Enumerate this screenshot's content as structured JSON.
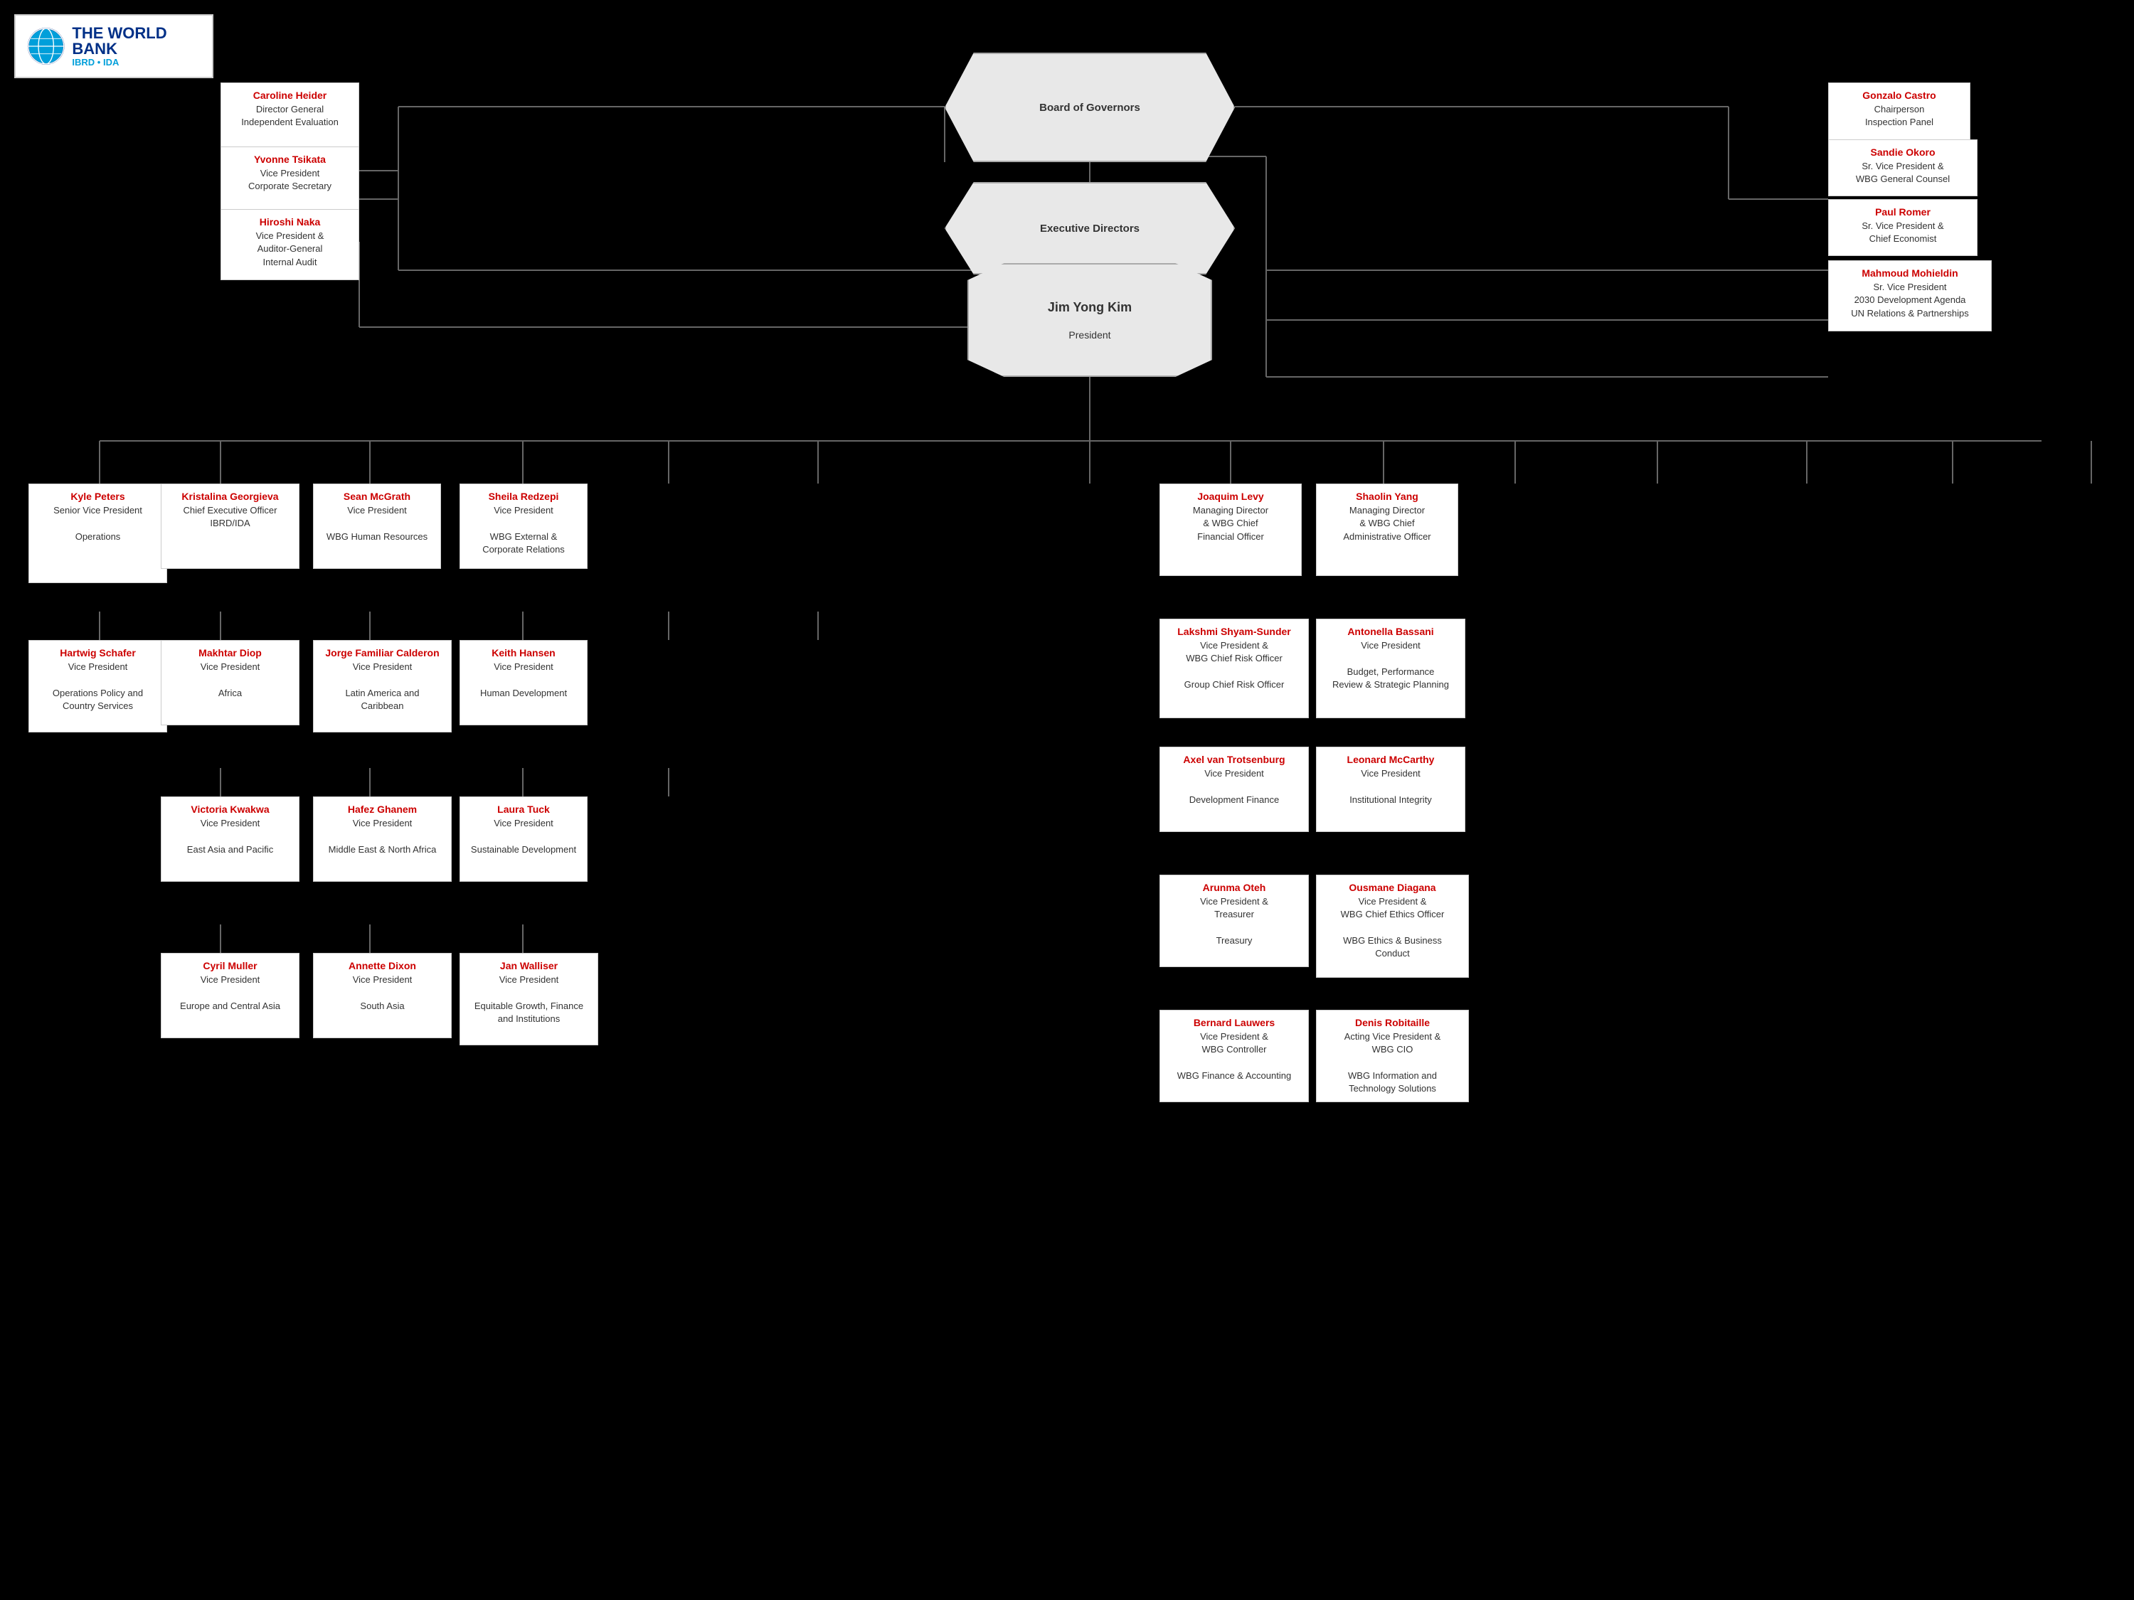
{
  "logo": {
    "title": "THE WORLD BANK",
    "subtitle": "IBRD • IDA"
  },
  "board_of_governors": {
    "label": "Board of Governors"
  },
  "executive_directors": {
    "label": "Executive Directors"
  },
  "president": {
    "name": "Jim Yong Kim",
    "title": "President"
  },
  "cards": {
    "caroline_heider": {
      "name": "Caroline Heider",
      "title": "Director General\nIndependent Evaluation"
    },
    "gonzalo_castro": {
      "name": "Gonzalo Castro",
      "title": "Chairperson\nInspection Panel"
    },
    "yvonne_tsikata": {
      "name": "Yvonne Tsikata",
      "title": "Vice President\nCorporate Secretary"
    },
    "hiroshi_naka": {
      "name": "Hiroshi Naka",
      "title": "Vice President &\nAuditor-General\nInternal Audit"
    },
    "sandie_okoro": {
      "name": "Sandie Okoro",
      "title": "Sr. Vice President &\nWBG General Counsel"
    },
    "paul_romer": {
      "name": "Paul Romer",
      "title": "Sr. Vice President &\nChief Economist"
    },
    "mahmoud_mohieldin": {
      "name": "Mahmoud Mohieldin",
      "title": "Sr. Vice President\n2030 Development Agenda\nUN Relations & Partnerships"
    },
    "kyle_peters": {
      "name": "Kyle Peters",
      "title": "Senior Vice President\n\nOperations"
    },
    "kristalina_georgieva": {
      "name": "Kristalina Georgieva",
      "title": "Chief Executive Officer\nIBRD/IDA"
    },
    "sean_mcgrath": {
      "name": "Sean McGrath",
      "title": "Vice President\n\nWBG Human Resources"
    },
    "sheila_redzepi": {
      "name": "Sheila Redzepi",
      "title": "Vice President\n\nWBG External &\nCorporate Relations"
    },
    "joaquim_levy": {
      "name": "Joaquim Levy",
      "title": "Managing Director\n& WBG Chief\nFinancial Officer"
    },
    "shaolin_yang": {
      "name": "Shaolin Yang",
      "title": "Managing Director\n& WBG Chief\nAdministrative Officer"
    },
    "hartwig_schafer": {
      "name": "Hartwig Schafer",
      "title": "Vice President\n\nOperations Policy and\nCountry Services"
    },
    "makhtar_diop": {
      "name": "Makhtar Diop",
      "title": "Vice President\n\nAfrica"
    },
    "jorge_familiar": {
      "name": "Jorge Familiar Calderon",
      "title": "Vice President\n\nLatin America and\nCaribbean"
    },
    "keith_hansen": {
      "name": "Keith Hansen",
      "title": "Vice President\n\nHuman Development"
    },
    "lakshmi_shyam_sunder": {
      "name": "Lakshmi Shyam-Sunder",
      "title": "Vice President &\nWBG Chief Risk Officer\n\nGroup Chief Risk Officer"
    },
    "antonella_bassani": {
      "name": "Antonella Bassani",
      "title": "Vice President\n\nBudget, Performance\nReview & Strategic Planning"
    },
    "victoria_kwakwa": {
      "name": "Victoria Kwakwa",
      "title": "Vice President\n\nEast Asia and Pacific"
    },
    "hafez_ghanem": {
      "name": "Hafez Ghanem",
      "title": "Vice President\n\nMiddle East & North Africa"
    },
    "laura_tuck": {
      "name": "Laura Tuck",
      "title": "Vice President\n\nSustainable Development"
    },
    "axel_van_trotsenburg": {
      "name": "Axel van Trotsenburg",
      "title": "Vice President\n\nDevelopment Finance"
    },
    "leonard_mccarthy": {
      "name": "Leonard McCarthy",
      "title": "Vice President\n\nInstitutional Integrity"
    },
    "cyril_muller": {
      "name": "Cyril Muller",
      "title": "Vice President\n\nEurope and Central Asia"
    },
    "annette_dixon": {
      "name": "Annette Dixon",
      "title": "Vice President\n\nSouth Asia"
    },
    "jan_walliser": {
      "name": "Jan Walliser",
      "title": "Vice President\n\nEquitable Growth, Finance\nand Institutions"
    },
    "arunma_oteh": {
      "name": "Arunma Oteh",
      "title": "Vice President &\nTreasurer\n\nTreasury"
    },
    "ousmane_diagana": {
      "name": "Ousmane Diagana",
      "title": "Vice President &\nWBG Chief Ethics Officer\n\nWBG Ethics & Business\nConduct"
    },
    "bernard_lauwers": {
      "name": "Bernard Lauwers",
      "title": "Vice President &\nWBG Controller\n\nWBG Finance & Accounting"
    },
    "denis_robitaille": {
      "name": "Denis Robitaille",
      "title": "Acting Vice President &\nWBG CIO\n\nWBG Information and\nTechnology Solutions"
    }
  }
}
